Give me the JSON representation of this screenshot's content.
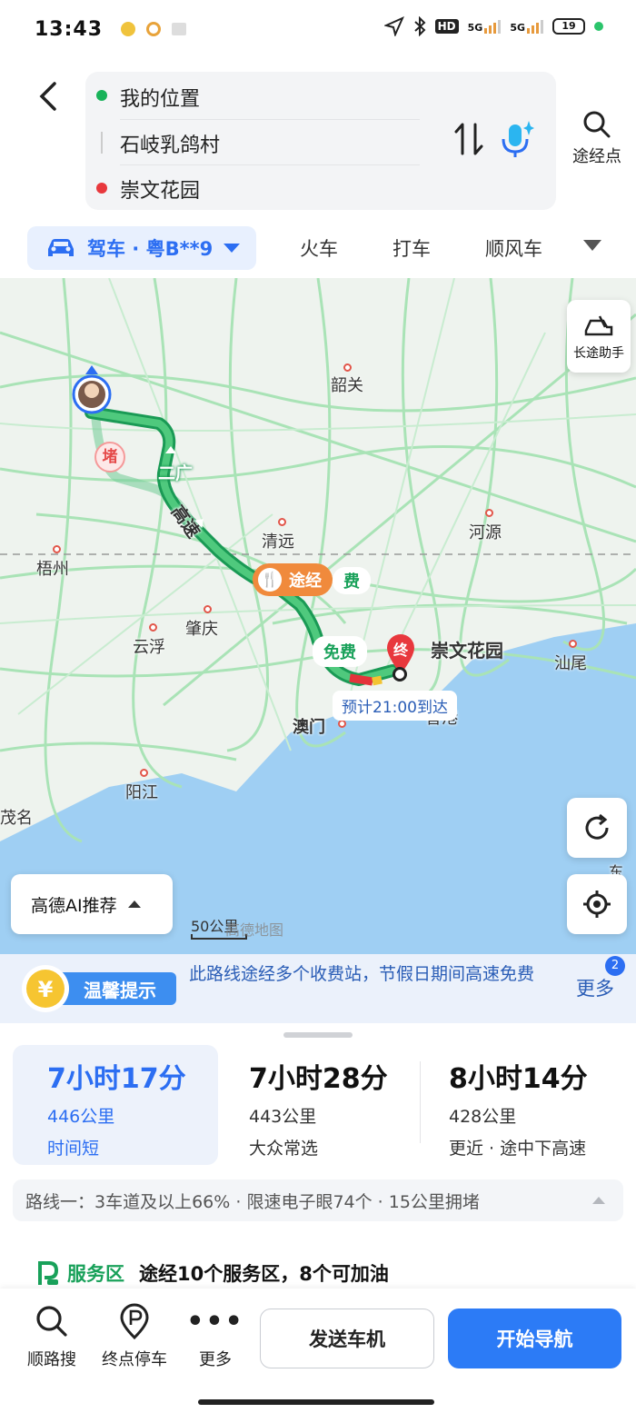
{
  "status": {
    "time": "13:43",
    "battery": "19",
    "net1": "5G",
    "net2": "5G",
    "hd": "HD"
  },
  "header": {
    "origin": "我的位置",
    "waypoint": "石岐乳鸽村",
    "destination": "崇文花园",
    "waypoint_button": "途经点"
  },
  "modes": {
    "drive": "驾车 · 粤B**9",
    "tabs": [
      "火车",
      "打车",
      "顺风车"
    ]
  },
  "map": {
    "cities": {
      "shaoguan": "韶关",
      "qingyuan": "清远",
      "heyuan": "河源",
      "wuzhou": "梧州",
      "zhaoqing": "肇庆",
      "yunfu": "云浮",
      "shanwei": "汕尾",
      "macau": "澳门",
      "yangjiang": "阳江",
      "maoming": "茂名",
      "hongkong": "香港",
      "dong": "东"
    },
    "road_label_1": "二广",
    "road_label_2": "高速",
    "jam_badge": "堵",
    "via_label": "途经",
    "fee_label": "费",
    "free_label": "免费",
    "end_pin": "终",
    "destination_label": "崇文花园",
    "eta": "预计21:00到达",
    "long_trip": "长途助手",
    "scale": "50公里",
    "watermark": "高德地图",
    "ai_recommend": "高德AI推荐"
  },
  "tip": {
    "badge": "温馨提示",
    "text": "此路线途经多个收费站，节假日期间高速免费",
    "more": "更多",
    "count": "2"
  },
  "routes": [
    {
      "time": "7小时17分",
      "distance": "446公里",
      "tag": "时间短"
    },
    {
      "time": "7小时28分",
      "distance": "443公里",
      "tag": "大众常选"
    },
    {
      "time": "8小时14分",
      "distance": "428公里",
      "tag": "更近 · 途中下高速"
    }
  ],
  "route_detail": "路线一：3车道及以上66% · 限速电子眼74个 · 15公里拥堵",
  "service": {
    "label": "服务区",
    "text": "途经10个服务区，8个可加油"
  },
  "actions": {
    "search": "顺路搜",
    "parking": "终点停车",
    "more": "更多",
    "send": "发送车机",
    "start": "开始导航"
  }
}
